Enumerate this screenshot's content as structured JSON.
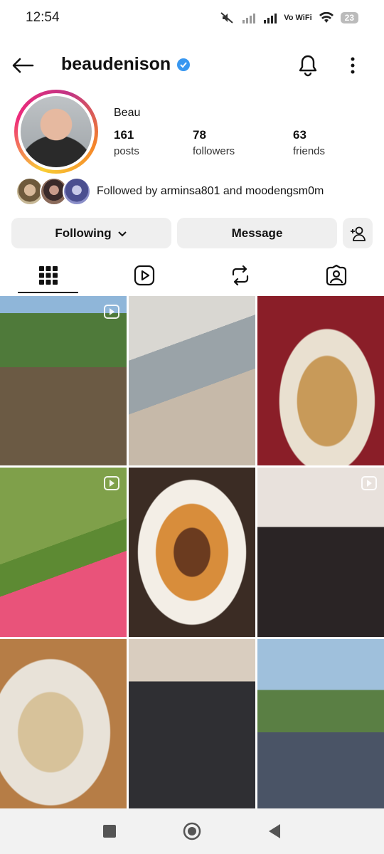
{
  "status_bar": {
    "time": "12:54",
    "vowifi": "Vo WiFi",
    "battery": "23"
  },
  "header": {
    "username": "beaudenison"
  },
  "profile": {
    "display_name": "Beau",
    "stats": [
      {
        "value": "161",
        "label": "posts"
      },
      {
        "value": "78",
        "label": "followers"
      },
      {
        "value": "63",
        "label": "friends"
      }
    ],
    "followed_by_prefix": "Followed by",
    "followed_user_1": "arminsa801",
    "followed_and": "and",
    "followed_user_2": "moodengsm0m"
  },
  "actions": {
    "following_label": "Following",
    "message_label": "Message"
  },
  "colors": {
    "verified": "#3897f0",
    "button_bg": "#efefef",
    "text": "#111111"
  }
}
